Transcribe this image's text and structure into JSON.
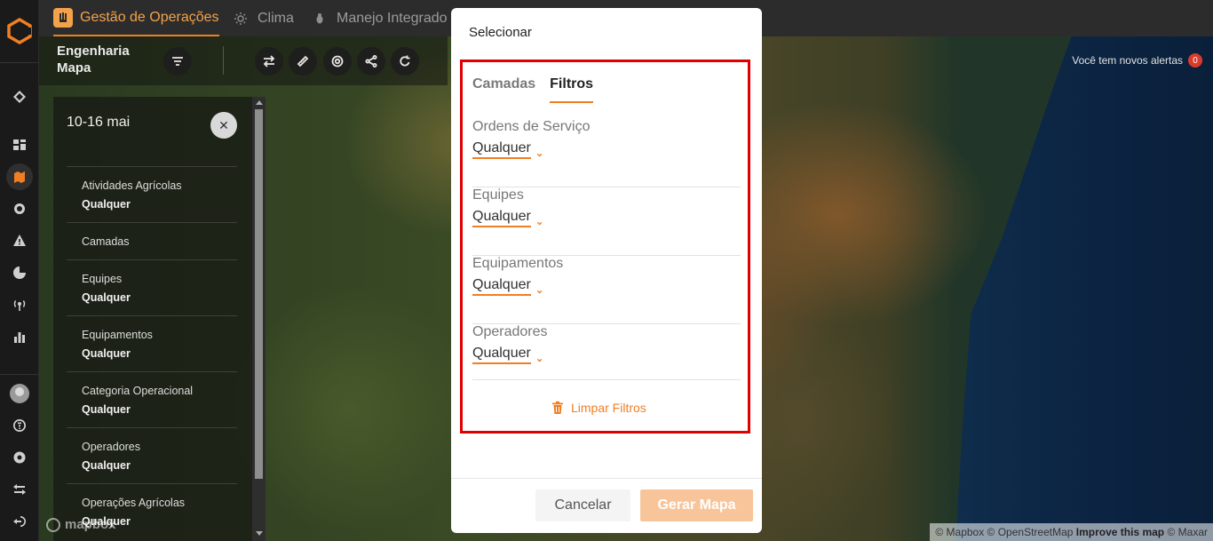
{
  "colors": {
    "accent": "#f07f23",
    "highlight": "#e00000",
    "badge": "#d93b2b"
  },
  "top_tabs": [
    {
      "label": "Gestão de Operações",
      "icon": "hand-icon",
      "active": true
    },
    {
      "label": "Clima",
      "icon": "sun-icon",
      "active": false
    },
    {
      "label": "Manejo Integrado",
      "icon": "bug-icon",
      "active": false
    }
  ],
  "map_header": {
    "title_line1": "Engenharia",
    "title_line2": "Mapa"
  },
  "alerts": {
    "text": "Você tem novos alertas",
    "count": "0"
  },
  "summary": {
    "date": "10-16 mai",
    "rows": [
      {
        "label": "Atividades Agrícolas",
        "value": "Qualquer"
      },
      {
        "label": "Camadas",
        "value": ""
      },
      {
        "label": "Equipes",
        "value": "Qualquer"
      },
      {
        "label": "Equipamentos",
        "value": "Qualquer"
      },
      {
        "label": "Categoria Operacional",
        "value": "Qualquer"
      },
      {
        "label": "Operadores",
        "value": "Qualquer"
      },
      {
        "label": "Operações Agrícolas",
        "value": "Qualquer"
      }
    ]
  },
  "modal": {
    "title": "Selecionar",
    "tabs": [
      {
        "label": "Camadas",
        "active": false
      },
      {
        "label": "Filtros",
        "active": true
      }
    ],
    "filters": [
      {
        "label": "Ordens de Serviço",
        "value": "Qualquer"
      },
      {
        "label": "Equipes",
        "value": "Qualquer"
      },
      {
        "label": "Equipamentos",
        "value": "Qualquer"
      },
      {
        "label": "Operadores",
        "value": "Qualquer"
      }
    ],
    "clear_label": "Limpar Filtros",
    "cancel_label": "Cancelar",
    "generate_label": "Gerar Mapa"
  },
  "mapbox_logo": "mapbox",
  "attribution": {
    "part1": "© Mapbox © OpenStreetMap ",
    "improve": "Improve this map",
    "part2": " © Maxar"
  }
}
